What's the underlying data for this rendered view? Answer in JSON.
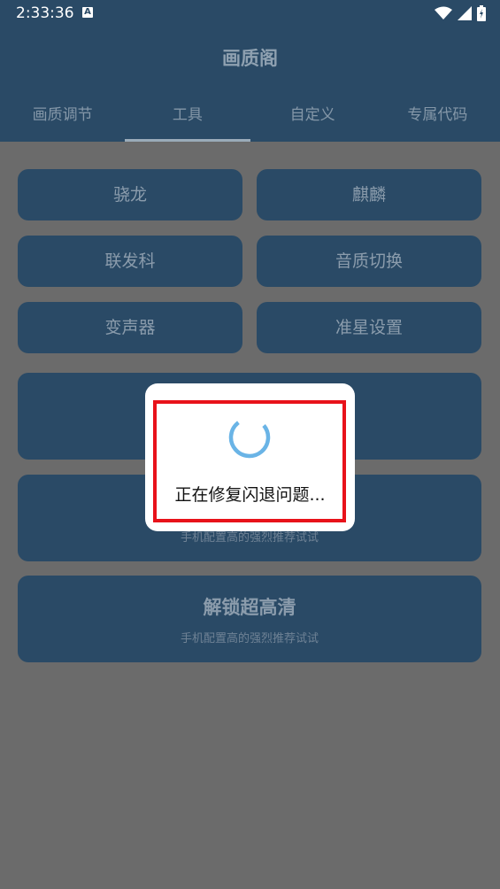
{
  "status": {
    "time": "2:33:36",
    "notif_letter": "A"
  },
  "app": {
    "title": "画质阁"
  },
  "tabs": [
    {
      "label": "画质调节",
      "active": false
    },
    {
      "label": "工具",
      "active": true
    },
    {
      "label": "自定义",
      "active": false
    },
    {
      "label": "专属代码",
      "active": false
    }
  ],
  "grid": {
    "b1": "骁龙",
    "b2": "麒麟",
    "b3": "联发科",
    "b4": "音质切换",
    "b5": "变声器",
    "b6": "准星设置"
  },
  "cards": {
    "card2_sub": "手机配置高的强烈推荐试试",
    "card3_title": "解锁超高清",
    "card3_sub": "手机配置高的强烈推荐试试"
  },
  "dialog": {
    "message": "正在修复闪退问题..."
  },
  "colors": {
    "primary": "#2a4a66",
    "overlay": "#6b6b6b",
    "highlight": "#e8121a",
    "spinner": "#6ab4e6"
  }
}
